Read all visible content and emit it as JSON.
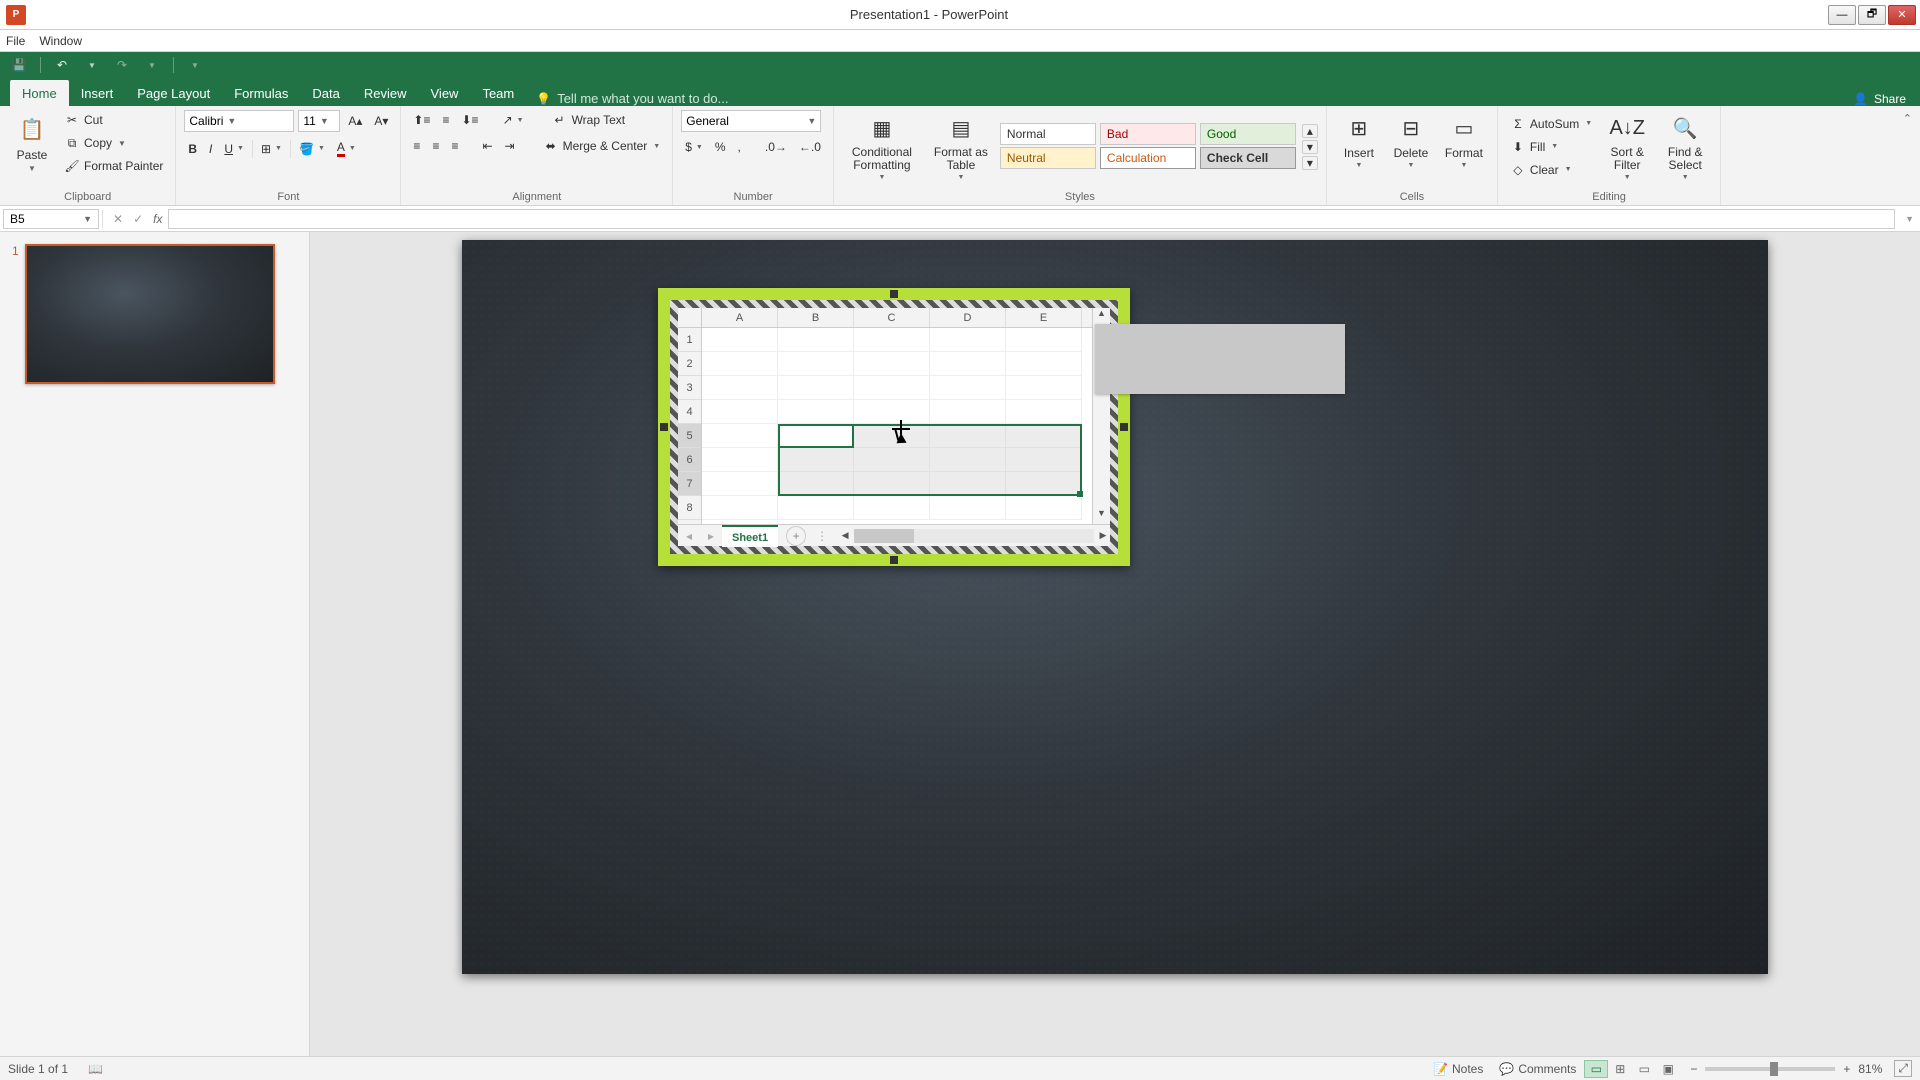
{
  "window": {
    "title": "Presentation1 - PowerPoint"
  },
  "menubar": {
    "file": "File",
    "window": "Window"
  },
  "tabs": {
    "home": "Home",
    "insert": "Insert",
    "pagelayout": "Page Layout",
    "formulas": "Formulas",
    "data": "Data",
    "review": "Review",
    "view": "View",
    "team": "Team",
    "tellme_placeholder": "Tell me what you want to do...",
    "share": "Share"
  },
  "ribbon": {
    "clipboard": {
      "cut": "Cut",
      "copy": "Copy",
      "format_painter": "Format Painter",
      "paste": "Paste",
      "label": "Clipboard"
    },
    "font": {
      "name": "Calibri",
      "size": "11",
      "label": "Font"
    },
    "alignment": {
      "wrap": "Wrap Text",
      "merge": "Merge & Center",
      "label": "Alignment"
    },
    "number": {
      "format": "General",
      "label": "Number"
    },
    "styles": {
      "cond": "Conditional Formatting",
      "table": "Format as Table",
      "normal": "Normal",
      "bad": "Bad",
      "good": "Good",
      "neutral": "Neutral",
      "calc": "Calculation",
      "check": "Check Cell",
      "label": "Styles"
    },
    "cells": {
      "insert": "Insert",
      "delete": "Delete",
      "format": "Format",
      "label": "Cells"
    },
    "editing": {
      "autosum": "AutoSum",
      "fill": "Fill",
      "clear": "Clear",
      "sort": "Sort & Filter",
      "find": "Find & Select",
      "label": "Editing"
    }
  },
  "namebox": {
    "ref": "B5"
  },
  "slidenav": {
    "thumb1": "1"
  },
  "ole": {
    "cols": [
      "A",
      "B",
      "C",
      "D",
      "E"
    ],
    "rows": [
      "1",
      "2",
      "3",
      "4",
      "5",
      "6",
      "7",
      "8"
    ],
    "sheet": "Sheet1"
  },
  "status": {
    "slide": "Slide 1 of 1",
    "notes": "Notes",
    "comments": "Comments",
    "zoom": "81%"
  }
}
